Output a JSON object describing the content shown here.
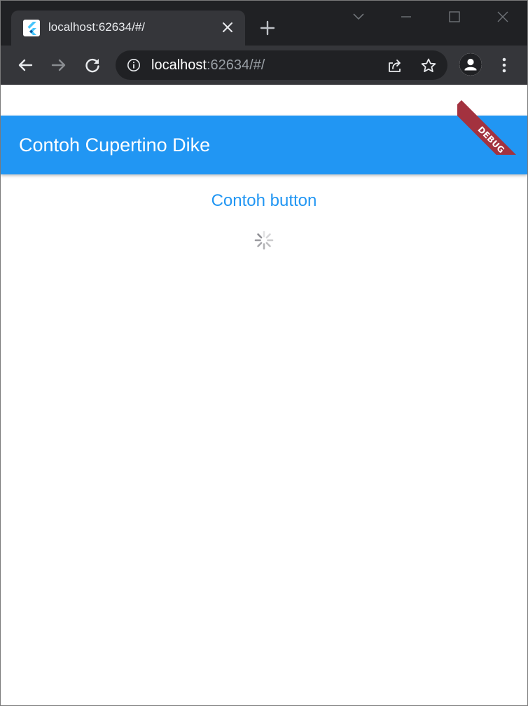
{
  "browser": {
    "tab": {
      "title": "localhost:62634/#/",
      "favicon": "flutter-icon"
    },
    "address": {
      "host": "localhost",
      "path": ":62634/#/"
    },
    "toolbar_icons": [
      "back-icon",
      "forward-icon",
      "reload-icon",
      "info-icon",
      "share-icon",
      "star-icon",
      "profile-icon",
      "menu-icon"
    ],
    "window_controls": [
      "tab-search-icon",
      "minimize-icon",
      "maximize-icon",
      "close-icon"
    ]
  },
  "app": {
    "appbar": {
      "title": "Contoh Cupertino Dike",
      "color": "#2196f3"
    },
    "button": {
      "label": "Contoh button",
      "color": "#2196f3"
    },
    "activity_indicator": "cupertino-spinner-icon",
    "debug_banner": {
      "label": "DEBUG",
      "color": "#a3323f"
    }
  }
}
